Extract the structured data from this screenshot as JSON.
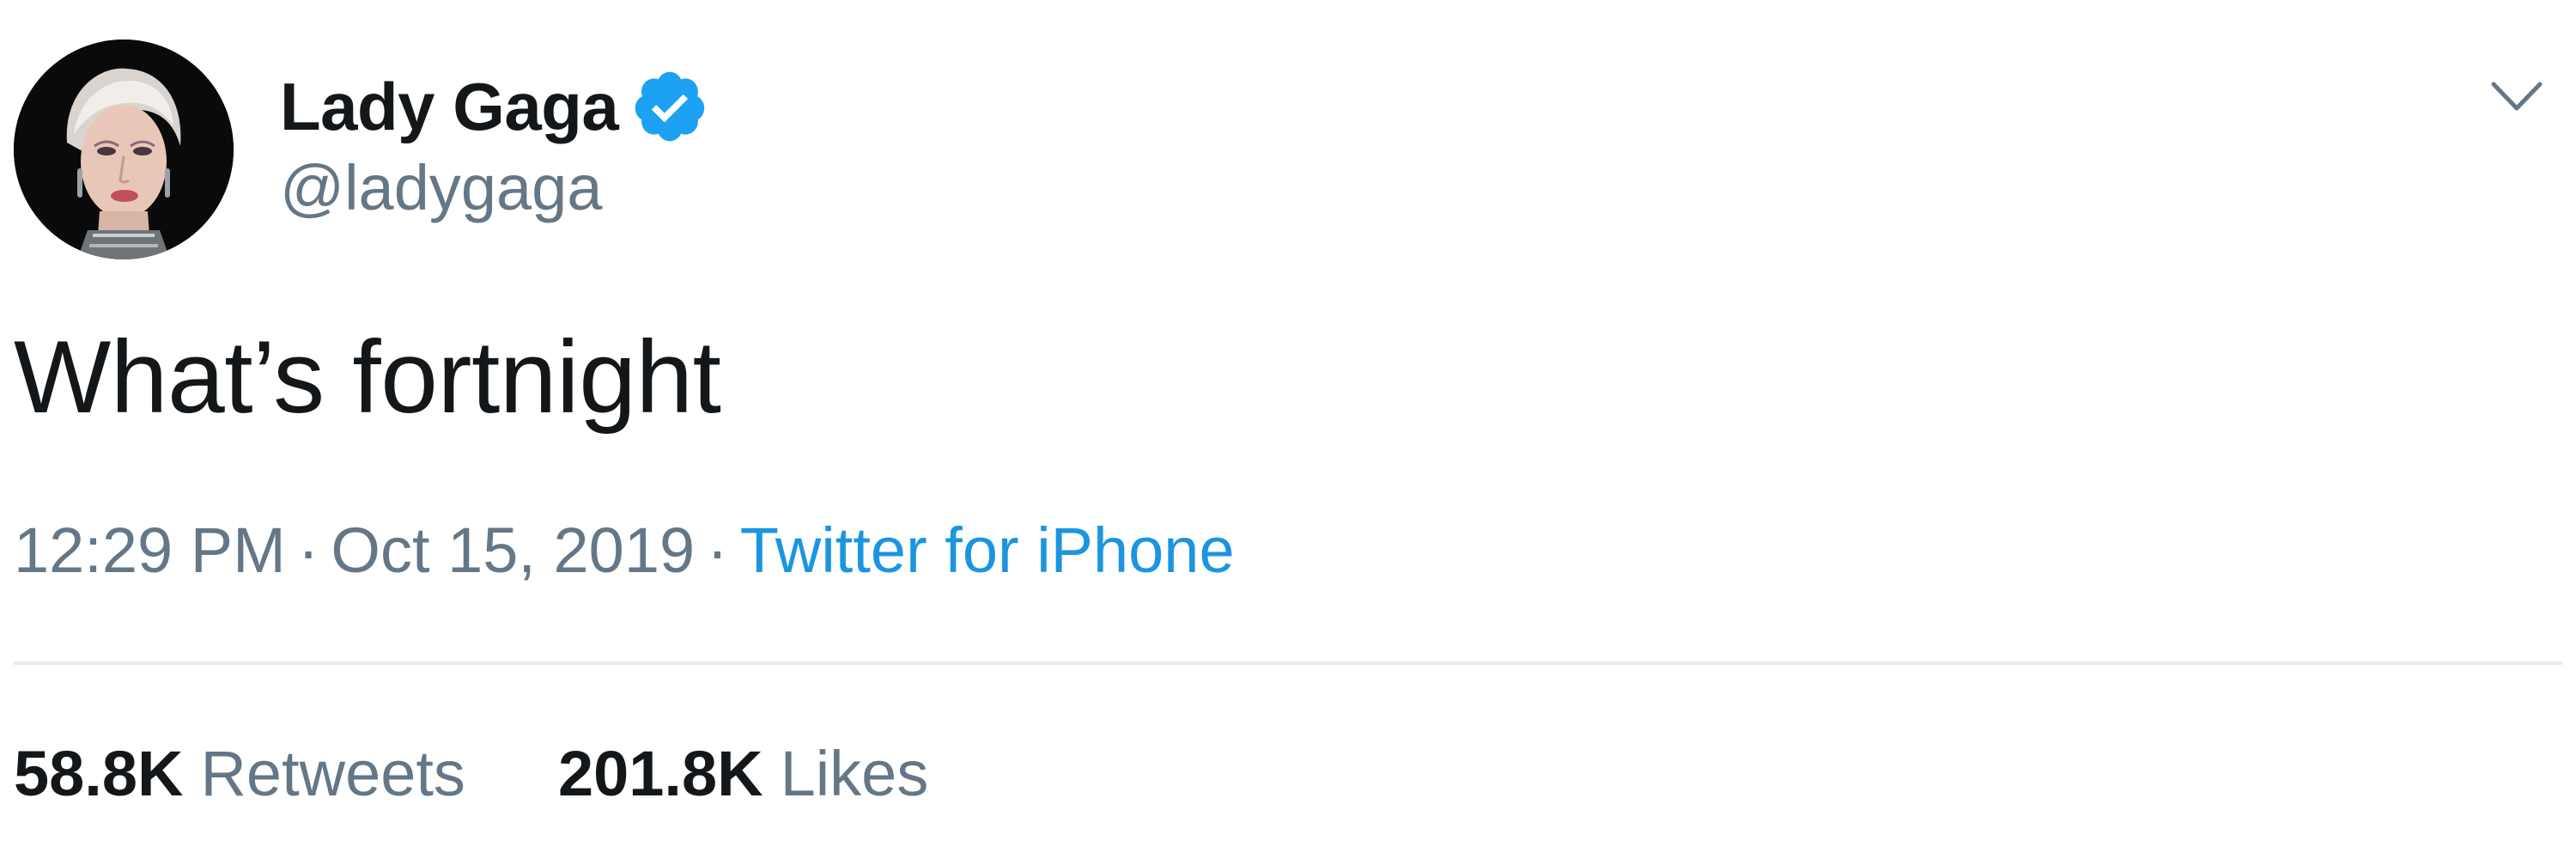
{
  "tweet": {
    "author": {
      "display_name": "Lady Gaga",
      "handle": "@ladygaga",
      "verified": true
    },
    "text": "What’s fortnight",
    "time": "12:29 PM",
    "date": "Oct 15, 2019",
    "separator": "·",
    "source": "Twitter for iPhone",
    "stats": {
      "retweets_count": "58.8K",
      "retweets_label": "Retweets",
      "likes_count": "201.8K",
      "likes_label": "Likes"
    }
  },
  "icons": {
    "verified": "verified-badge-icon",
    "menu": "chevron-down-icon"
  },
  "colors": {
    "text_primary": "#14171a",
    "text_secondary": "#657786",
    "link": "#1b95e0",
    "verified": "#1da1f2",
    "divider": "#e6ecf0"
  }
}
